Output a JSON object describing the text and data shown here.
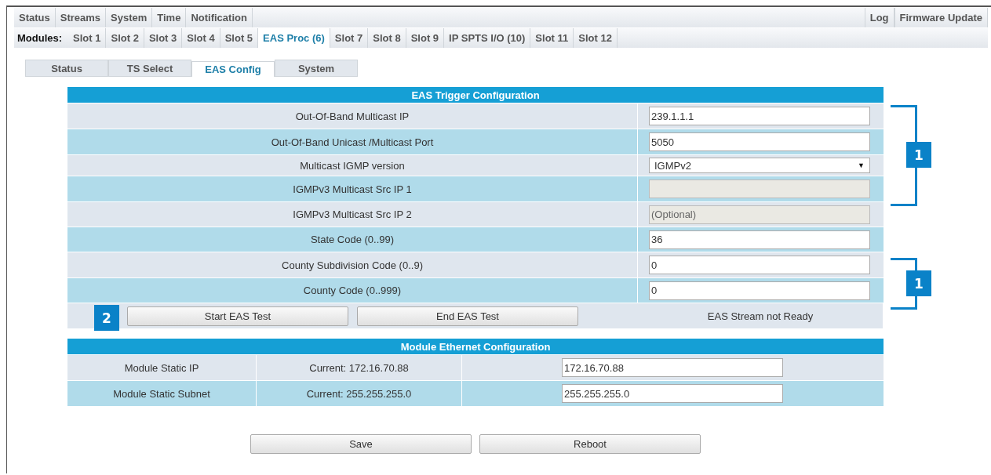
{
  "nav": {
    "left": [
      {
        "label": "Status",
        "selected": false
      },
      {
        "label": "Streams",
        "selected": false
      },
      {
        "label": "System",
        "selected": false
      },
      {
        "label": "Time",
        "selected": false
      },
      {
        "label": "Notification",
        "selected": false
      }
    ],
    "right": [
      {
        "label": "Log",
        "selected": false
      },
      {
        "label": "Firmware Update",
        "selected": false
      }
    ]
  },
  "modules": {
    "label": "Modules:",
    "items": [
      {
        "label": "Slot 1",
        "selected": false
      },
      {
        "label": "Slot 2",
        "selected": false
      },
      {
        "label": "Slot 3",
        "selected": false
      },
      {
        "label": "Slot 4",
        "selected": false
      },
      {
        "label": "Slot 5",
        "selected": false
      },
      {
        "label": "EAS Proc (6)",
        "selected": true
      },
      {
        "label": "Slot 7",
        "selected": false
      },
      {
        "label": "Slot 8",
        "selected": false
      },
      {
        "label": "Slot 9",
        "selected": false
      },
      {
        "label": "IP SPTS I/O (10)",
        "selected": false
      },
      {
        "label": "Slot 11",
        "selected": false
      },
      {
        "label": "Slot 12",
        "selected": false
      }
    ]
  },
  "subtabs": [
    {
      "label": "Status",
      "selected": false
    },
    {
      "label": "TS Select",
      "selected": false
    },
    {
      "label": "EAS Config",
      "selected": true
    },
    {
      "label": "System",
      "selected": false
    }
  ],
  "eas_trigger": {
    "title": "EAS Trigger Configuration",
    "rows": [
      {
        "label": "Out-Of-Band Multicast IP",
        "kind": "input",
        "value": "239.1.1.1",
        "disabled": false
      },
      {
        "label": "Out-Of-Band Unicast /Multicast Port",
        "kind": "input",
        "value": "5050",
        "disabled": false
      },
      {
        "label": "Multicast IGMP version",
        "kind": "select",
        "value": "IGMPv2",
        "caret": "▼"
      },
      {
        "label": "IGMPv3 Multicast Src IP 1",
        "kind": "input",
        "disabled": true
      },
      {
        "label": "IGMPv3 Multicast Src IP 2",
        "kind": "input",
        "placeholder": "(Optional)",
        "disabled": true
      },
      {
        "label": "State Code (0..99)",
        "kind": "input",
        "value": "36",
        "disabled": false
      },
      {
        "label": "County Subdivision Code (0..9)",
        "kind": "input",
        "value": "0",
        "disabled": false
      },
      {
        "label": "County Code (0..999)",
        "kind": "input",
        "value": "0",
        "disabled": false
      }
    ],
    "buttons": [
      "Start EAS Test",
      "End EAS Test"
    ],
    "status": "EAS Stream not Ready"
  },
  "ethernet": {
    "title": "Module Ethernet Configuration",
    "rows": [
      {
        "label": "Module Static IP",
        "current": "Current: 172.16.70.88",
        "value": "172.16.70.88"
      },
      {
        "label": "Module Static Subnet",
        "current": "Current: 255.255.255.0",
        "value": "255.255.255.0"
      }
    ]
  },
  "buttons": [
    "Save",
    "Reboot"
  ],
  "callouts": [
    {
      "label": "1"
    },
    {
      "label": "1"
    },
    {
      "label": "2"
    }
  ]
}
